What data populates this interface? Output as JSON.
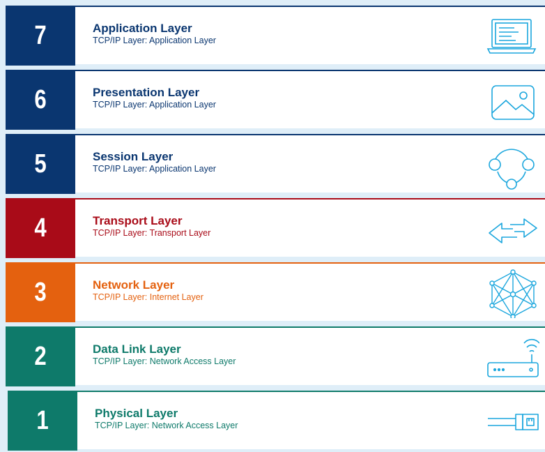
{
  "layers": [
    {
      "number": "7",
      "title": "Application Layer",
      "subtitle": "TCP/IP Layer: Application Layer",
      "color": "#0a3670",
      "icon": "laptop-icon"
    },
    {
      "number": "6",
      "title": "Presentation Layer",
      "subtitle": "TCP/IP Layer: Application Layer",
      "color": "#0a3670",
      "icon": "image-icon"
    },
    {
      "number": "5",
      "title": "Session Layer",
      "subtitle": "TCP/IP Layer: Application Layer",
      "color": "#0a3670",
      "icon": "session-nodes-icon"
    },
    {
      "number": "4",
      "title": "Transport Layer",
      "subtitle": "TCP/IP Layer: Transport Layer",
      "color": "#a90b18",
      "icon": "bidirectional-arrows-icon"
    },
    {
      "number": "3",
      "title": "Network Layer",
      "subtitle": "TCP/IP Layer: Internet Layer",
      "color": "#e4610f",
      "icon": "network-mesh-icon"
    },
    {
      "number": "2",
      "title": "Data Link Layer",
      "subtitle": "TCP/IP Layer: Network Access Layer",
      "color": "#0e7a6a",
      "icon": "wifi-router-icon"
    },
    {
      "number": "1",
      "title": "Physical Layer",
      "subtitle": "TCP/IP Layer: Network Access Layer",
      "color": "#0e7a6a",
      "icon": "ethernet-cable-icon"
    }
  ],
  "icon_color": "#1aa6dd",
  "background_color": "#dfeef8"
}
